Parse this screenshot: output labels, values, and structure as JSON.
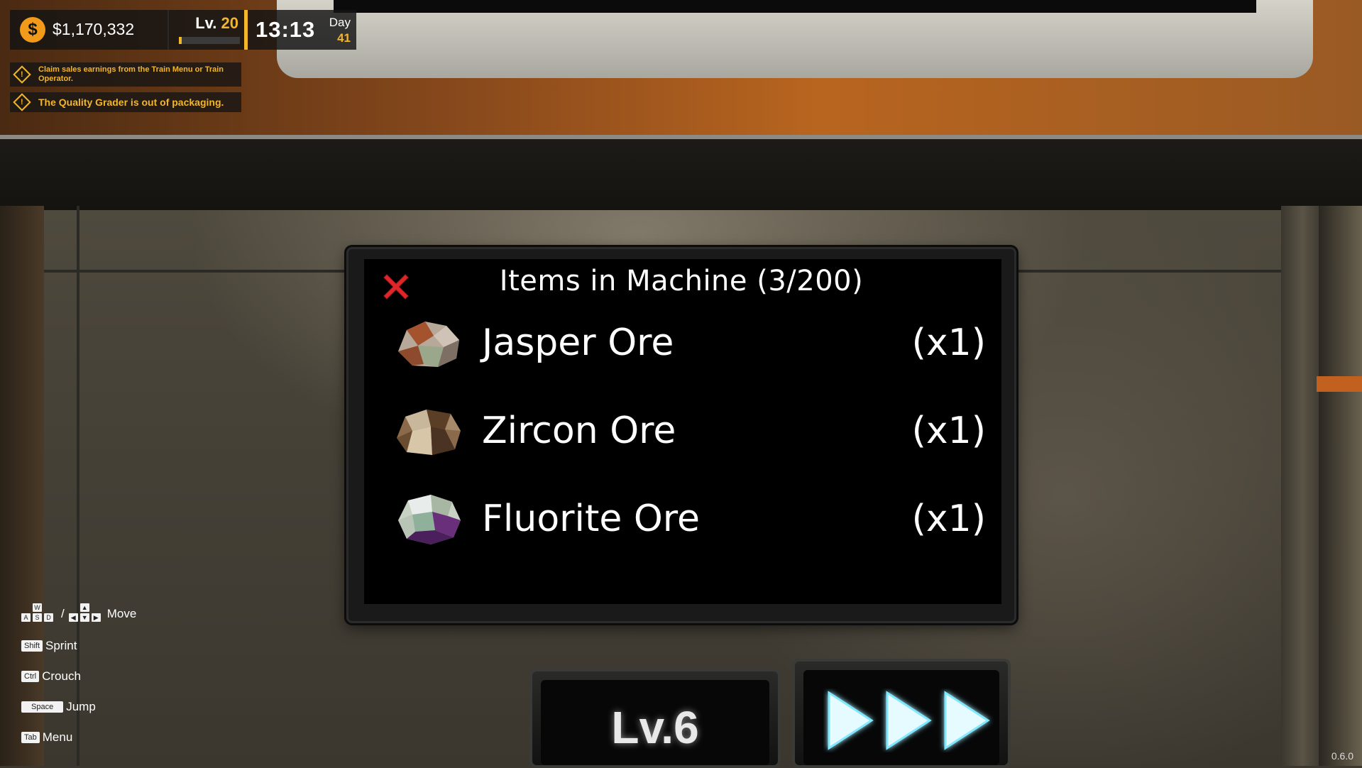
{
  "hud": {
    "money": "$1,170,332",
    "currency_symbol": "$",
    "level_label": "Lv.",
    "level_value": "20",
    "level_progress": 0.05,
    "time": "13:13",
    "day_label": "Day",
    "day_value": "41"
  },
  "notifications": [
    {
      "text": "Claim sales earnings from the Train Menu or Train Operator.",
      "icon": "warning-diamond-icon"
    },
    {
      "text": "The Quality Grader is out of packaging.",
      "icon": "warning-diamond-icon"
    }
  ],
  "dialog": {
    "title": "Items in Machine (3/200)",
    "items": [
      {
        "name": "Jasper Ore",
        "qty": "(x1)",
        "icon": "jasper-ore-icon"
      },
      {
        "name": "Zircon Ore",
        "qty": "(x1)",
        "icon": "zircon-ore-icon"
      },
      {
        "name": "Fluorite Ore",
        "qty": "(x1)",
        "icon": "fluorite-ore-icon"
      }
    ]
  },
  "machine": {
    "level_text": "Lv.6",
    "speed_icon": "triple-play-icon"
  },
  "controls": [
    {
      "keys": [
        "W",
        "A",
        "S",
        "D"
      ],
      "alt": "arrow-keys",
      "label": "Move"
    },
    {
      "keys": [
        "Shift"
      ],
      "label": "Sprint"
    },
    {
      "keys": [
        "Ctrl"
      ],
      "label": "Crouch"
    },
    {
      "keys": [
        "Space"
      ],
      "label": "Jump"
    },
    {
      "keys": [
        "Tab"
      ],
      "label": "Menu"
    }
  ],
  "version": "0.6.0",
  "colors": {
    "accent": "#f3b52a",
    "coin": "#f29a1a",
    "close": "#e0262a"
  }
}
